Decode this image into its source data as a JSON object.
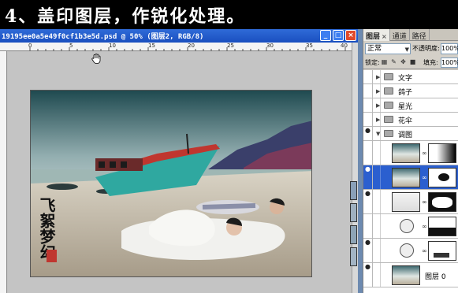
{
  "banner": {
    "text": "4、盖印图层，作锐化处理。"
  },
  "document": {
    "title": "19195ee0a5e49f0cf1b3e5d.psd @ 50% (图层2, RGB/8)",
    "buttons": [
      "_",
      "□",
      "×"
    ],
    "ruler_labels": [
      "0",
      "5",
      "10",
      "15",
      "20",
      "25",
      "30",
      "35",
      "40"
    ]
  },
  "photo": {
    "calligraphy": "飞絮梦幻"
  },
  "layers_panel": {
    "tabs": [
      "图层",
      "通道",
      "路径"
    ],
    "tab_close": "×",
    "blend_mode": "正常",
    "opacity_label": "不透明度:",
    "opacity_value": "100%",
    "lock_label": "锁定:",
    "fill_label": "填充:",
    "fill_value": "100%",
    "groups": [
      "文字",
      "鸽子",
      "星光",
      "花伞",
      "调图"
    ],
    "bottom_layer_name": "图层 0"
  },
  "colors": {
    "title_bar": "#1a4fbf",
    "selected_layer": "#2b5fcf",
    "boat_red": "#c0362f",
    "boat_teal": "#2fa8a0"
  }
}
